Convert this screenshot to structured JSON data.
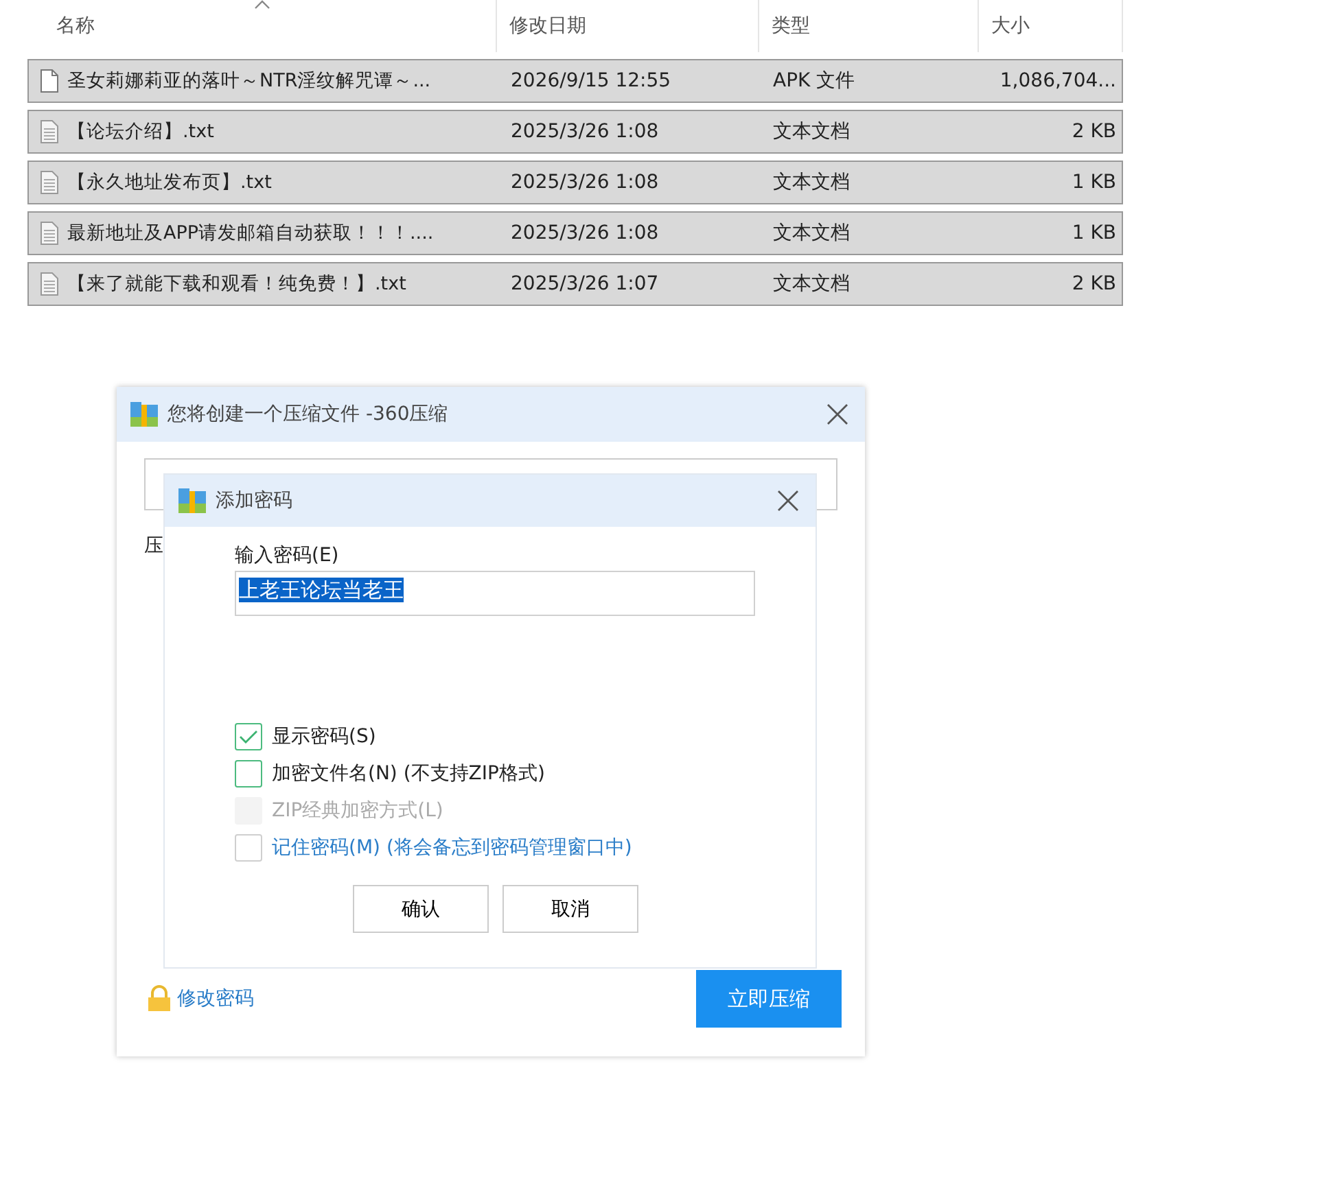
{
  "file_list": {
    "columns": [
      {
        "label": "名称",
        "sorted": true
      },
      {
        "label": "修改日期",
        "sorted": false
      },
      {
        "label": "类型",
        "sorted": false
      },
      {
        "label": "大小",
        "sorted": false
      }
    ],
    "rows": [
      {
        "kind": "apk",
        "name": "圣女莉娜莉亚的落叶～NTR淫纹解咒谭～...",
        "date": "2026/9/15 12:55",
        "type": "APK 文件",
        "size": "1,086,704...",
        "selected": true
      },
      {
        "kind": "txt",
        "name": "【论坛介绍】.txt",
        "date": "2025/3/26 1:08",
        "type": "文本文档",
        "size": "2 KB",
        "selected": true
      },
      {
        "kind": "txt",
        "name": "【永久地址发布页】.txt",
        "date": "2025/3/26 1:08",
        "type": "文本文档",
        "size": "1 KB",
        "selected": true
      },
      {
        "kind": "txt",
        "name": "最新地址及APP请发邮箱自动获取！！！....",
        "date": "2025/3/26 1:08",
        "type": "文本文档",
        "size": "1 KB",
        "selected": true
      },
      {
        "kind": "txt",
        "name": "【来了就能下载和观看！纯免费！】.txt",
        "date": "2025/3/26 1:07",
        "type": "文本文档",
        "size": "2 KB",
        "selected": true
      }
    ]
  },
  "compress_dialog": {
    "title": "您将创建一个压缩文件 -360压缩",
    "label_fragment": "压",
    "change_password": "修改密码",
    "compress_button": "立即压缩"
  },
  "password_dialog": {
    "title": "添加密码",
    "field_label": "输入密码(E)",
    "value": "上老王论坛当老王",
    "value_selected": true,
    "options": [
      {
        "kind": "plain",
        "label": "显示密码(S)",
        "checked": true,
        "disabled": false
      },
      {
        "kind": "plain",
        "label": "加密文件名(N) (不支持ZIP格式)",
        "checked": false,
        "disabled": false
      },
      {
        "kind": "plain",
        "label": "ZIP经典加密方式(L)",
        "checked": false,
        "disabled": true
      },
      {
        "kind": "link",
        "label": "记住密码(M) (将会备忘到密码管理窗口中)",
        "checked": false,
        "disabled": false
      }
    ],
    "buttons": [
      "确认",
      "取消"
    ]
  }
}
